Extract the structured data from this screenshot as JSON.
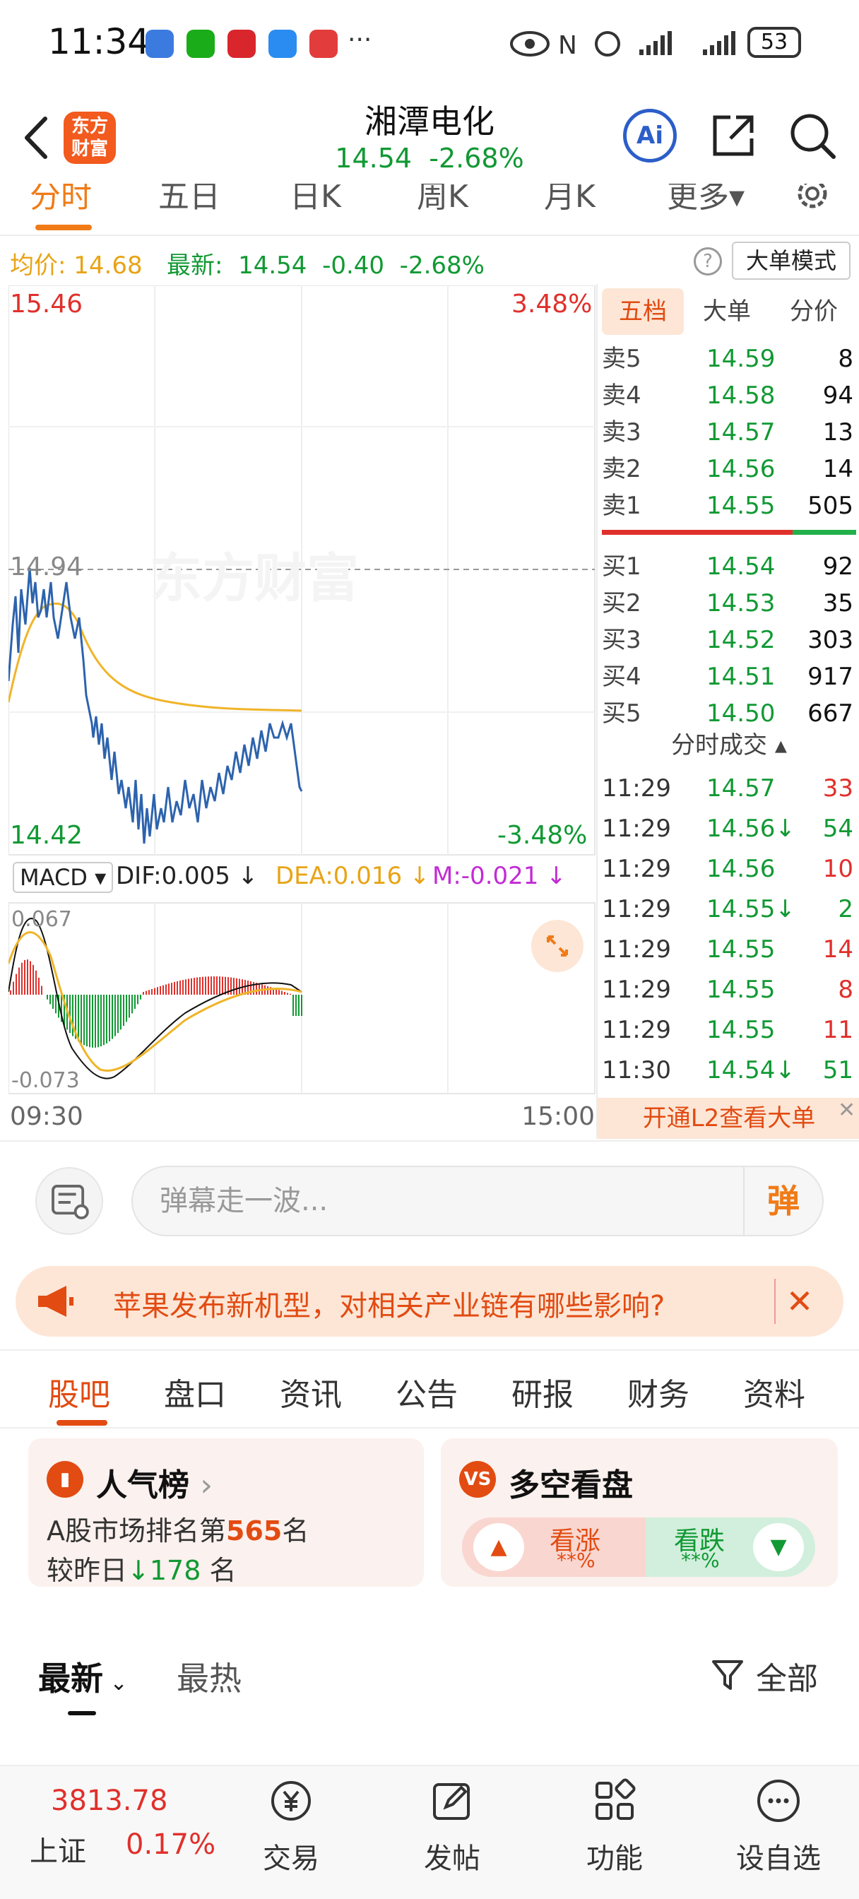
{
  "status_bar": {
    "time": "11:34",
    "more": "···",
    "battery": "53"
  },
  "header": {
    "logo_text": "东方财富",
    "stock_name": "湘潭电化",
    "price": "14.54",
    "change_pct": "-2.68%",
    "ai_label": "Ai"
  },
  "period_tabs": [
    "分时",
    "五日",
    "日K",
    "周K",
    "月K",
    "更多▾"
  ],
  "info": {
    "avg_label": "均价:",
    "avg_value": "14.68",
    "latest_label": "最新:",
    "latest_value": "14.54",
    "change": "-0.40",
    "change_pct": "-2.68%",
    "help": "?",
    "big_order_mode": "大单模式"
  },
  "chart": {
    "high_price": "15.46",
    "low_price": "14.42",
    "mid_price": "14.94",
    "high_pct": "3.48%",
    "low_pct": "-3.48%",
    "watermark": "东方财富",
    "macd_label": "MACD ▾",
    "dif": "DIF:0.005 ↓",
    "dea": "DEA:0.016 ↓",
    "m": "M:-0.021 ↓",
    "macd_top": "0.067",
    "macd_bottom": "-0.073",
    "time_start": "09:30",
    "time_end": "15:00"
  },
  "order_book": {
    "tabs": [
      "五档",
      "大单",
      "分价"
    ],
    "asks": [
      {
        "label": "卖5",
        "price": "14.59",
        "volume": "8"
      },
      {
        "label": "卖4",
        "price": "14.58",
        "volume": "94"
      },
      {
        "label": "卖3",
        "price": "14.57",
        "volume": "13"
      },
      {
        "label": "卖2",
        "price": "14.56",
        "volume": "14"
      },
      {
        "label": "卖1",
        "price": "14.55",
        "volume": "505"
      }
    ],
    "bids": [
      {
        "label": "买1",
        "price": "14.54",
        "volume": "92"
      },
      {
        "label": "买2",
        "price": "14.53",
        "volume": "35"
      },
      {
        "label": "买3",
        "price": "14.52",
        "volume": "303"
      },
      {
        "label": "买4",
        "price": "14.51",
        "volume": "917"
      },
      {
        "label": "买5",
        "price": "14.50",
        "volume": "667"
      }
    ],
    "trades_header": "分时成交 ▴",
    "trades": [
      {
        "time": "11:29",
        "price": "14.57",
        "volume": "33",
        "dir": "red"
      },
      {
        "time": "11:29",
        "price": "14.56↓",
        "volume": "54",
        "dir": "green"
      },
      {
        "time": "11:29",
        "price": "14.56",
        "volume": "10",
        "dir": "red"
      },
      {
        "time": "11:29",
        "price": "14.55↓",
        "volume": "2",
        "dir": "green"
      },
      {
        "time": "11:29",
        "price": "14.55",
        "volume": "14",
        "dir": "red"
      },
      {
        "time": "11:29",
        "price": "14.55",
        "volume": "8",
        "dir": "red"
      },
      {
        "time": "11:29",
        "price": "14.55",
        "volume": "11",
        "dir": "red"
      },
      {
        "time": "11:30",
        "price": "14.54↓",
        "volume": "51",
        "dir": "green"
      }
    ],
    "l2_banner": "开通L2查看大单"
  },
  "danmaku": {
    "placeholder": "弹幕走一波...",
    "send": "弹"
  },
  "news_banner": {
    "text": "苹果发布新机型，对相关产业链有哪些影响?"
  },
  "section_tabs": [
    "股吧",
    "盘口",
    "资讯",
    "公告",
    "研报",
    "财务",
    "资料"
  ],
  "cards": {
    "popularity": {
      "title": "人气榜",
      "rank_prefix": "A股市场排名第",
      "rank": "565",
      "rank_suffix": "名",
      "change_prefix": "较昨日",
      "change_value": "178",
      "change_suffix": "名"
    },
    "sentiment": {
      "title": "多空看盘",
      "up_label": "看涨",
      "up_pct": "**%",
      "down_label": "看跌",
      "down_pct": "**%"
    }
  },
  "sort": {
    "latest": "最新",
    "hot": "最热",
    "all": "全部"
  },
  "bottom_nav": {
    "index_value": "3813.78",
    "index_name": "上证",
    "index_change": "0.17%",
    "items": [
      "交易",
      "发帖",
      "功能",
      "设自选"
    ]
  },
  "colors": {
    "up": "#e0302b",
    "down": "#119933",
    "accent": "#f07b17",
    "price_line": "#2d63ad",
    "avg_line": "#f0b429"
  }
}
